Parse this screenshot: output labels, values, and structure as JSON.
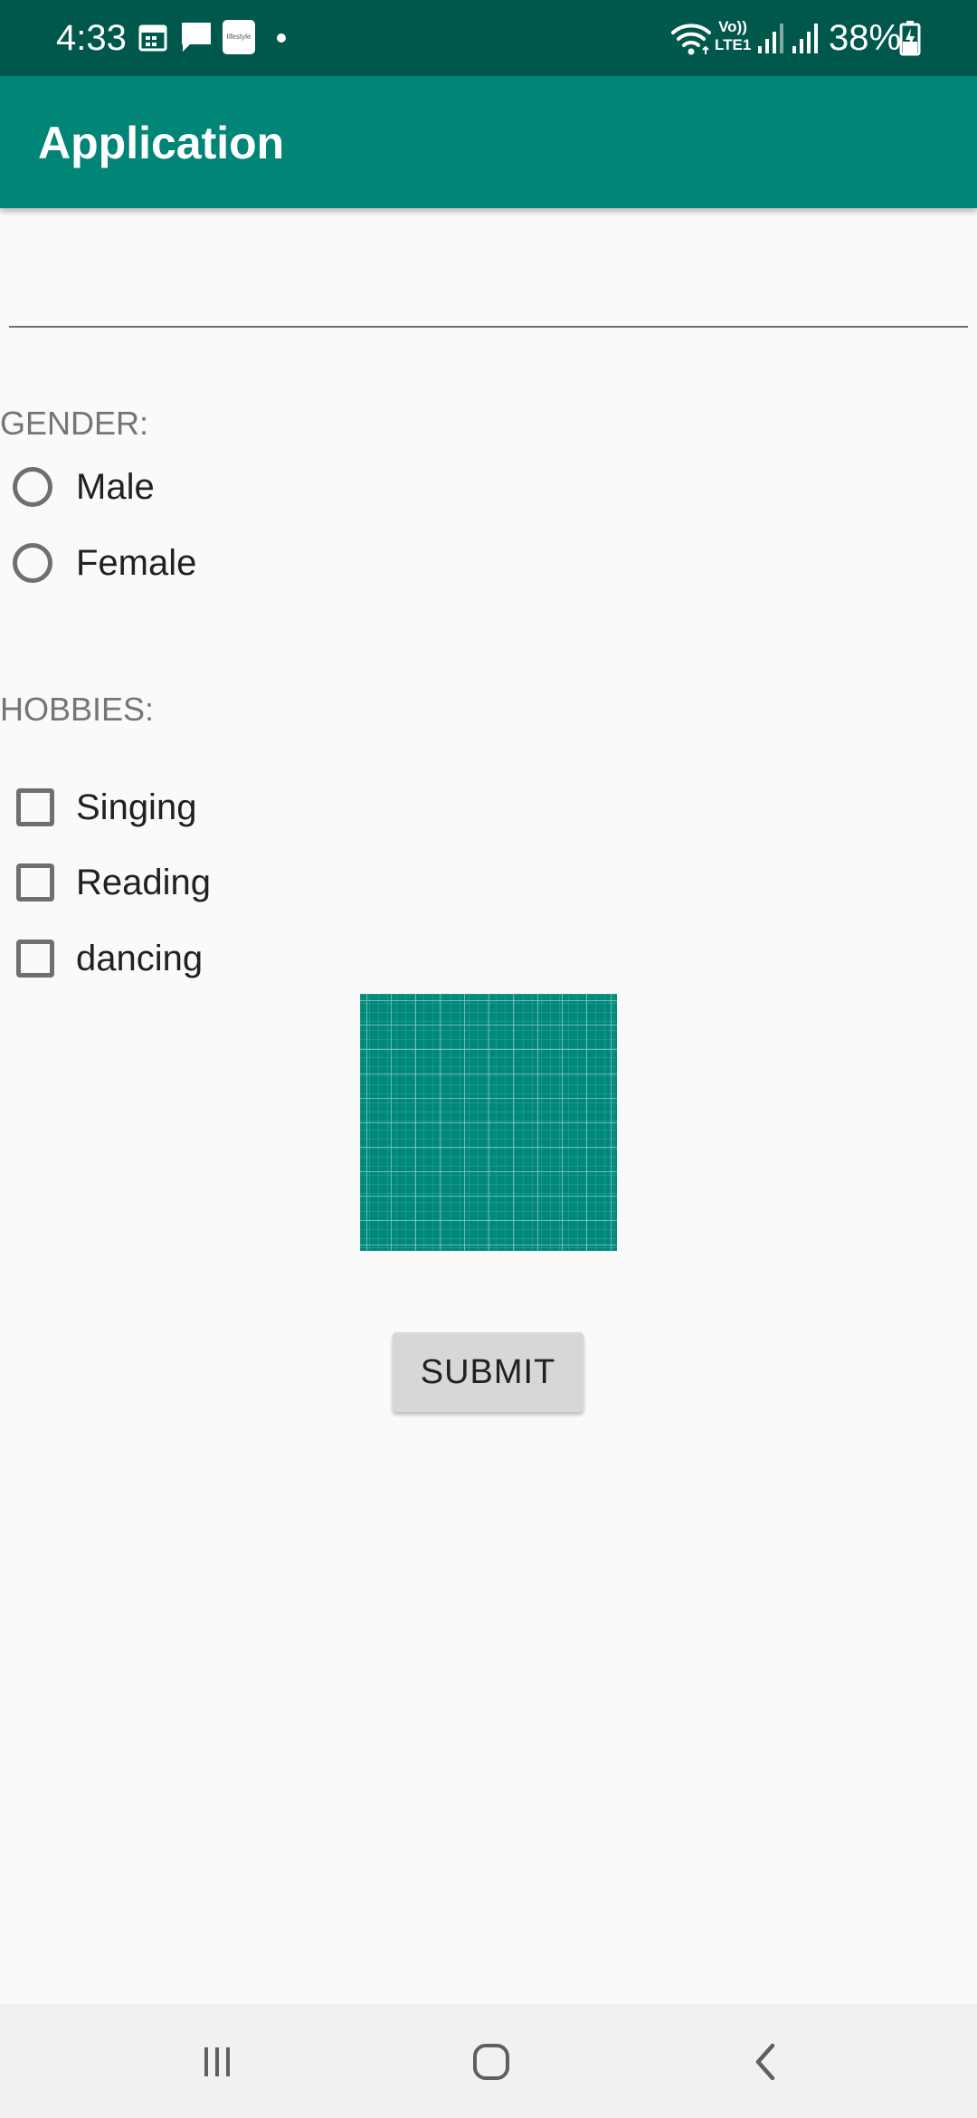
{
  "status_bar": {
    "time": "4:33",
    "lifestyle_badge": "lifestyle",
    "network_label_top": "Vo))",
    "network_label_bottom": "LTE1",
    "battery_percent": "38%",
    "icons": [
      "calendar-icon",
      "message-icon",
      "lifestyle-app-icon",
      "notification-dot-icon",
      "wifi-icon",
      "volte-icon",
      "signal-icon",
      "signal-icon",
      "battery-charging-icon"
    ]
  },
  "app_bar": {
    "title": "Application"
  },
  "form": {
    "text_input": {
      "value": "",
      "placeholder": ""
    },
    "gender": {
      "label": "GENDER:",
      "options": [
        {
          "label": "Male",
          "checked": false
        },
        {
          "label": "Female",
          "checked": false
        }
      ]
    },
    "hobbies": {
      "label": "HOBBIES:",
      "options": [
        {
          "label": "Singing",
          "checked": false
        },
        {
          "label": "Reading",
          "checked": false
        },
        {
          "label": "dancing",
          "checked": false
        }
      ]
    },
    "image": {
      "icon": "grid-placeholder-image",
      "color": "#00897b"
    },
    "submit_label": "SUBMIT"
  },
  "nav_bar": {
    "icons": [
      "recent-apps-icon",
      "home-icon",
      "back-icon"
    ]
  },
  "colors": {
    "status_bar": "#00574b",
    "app_bar": "#008577",
    "accent": "#00897b",
    "background": "#fafafa",
    "button": "#d6d7d7"
  }
}
